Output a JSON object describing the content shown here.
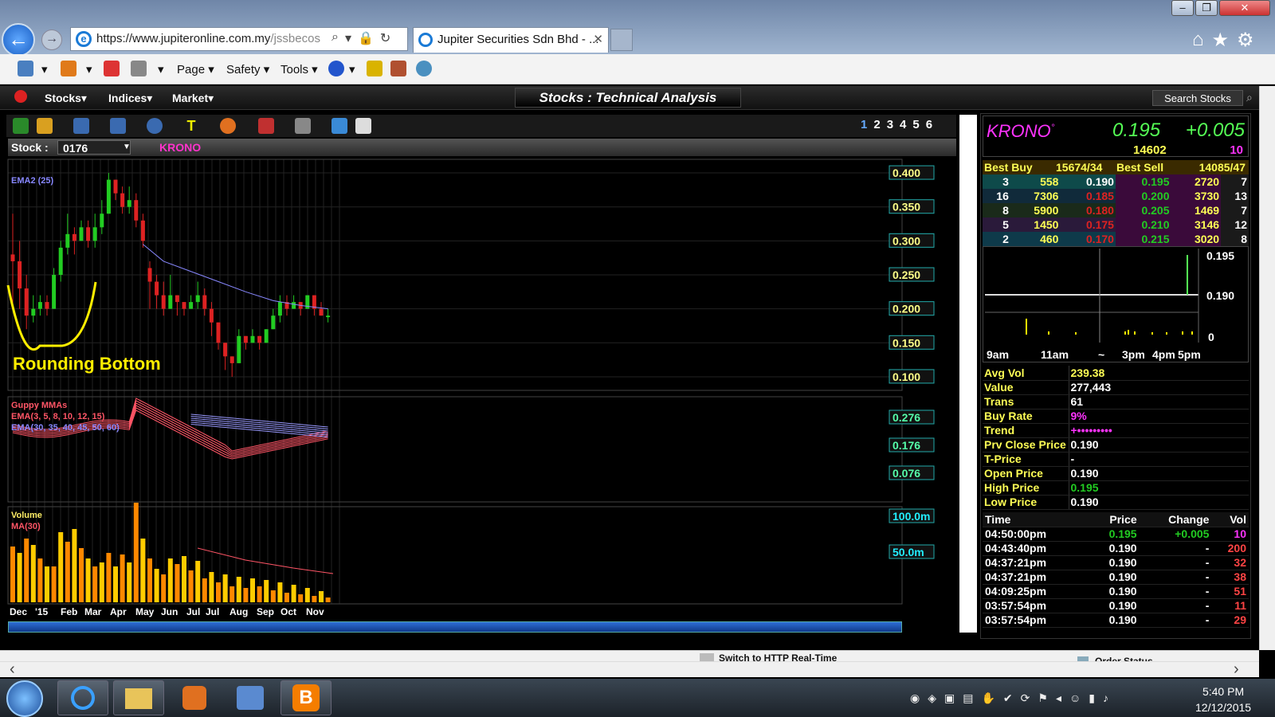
{
  "browser": {
    "url_main": "https://www.jupiteronline.com.my",
    "url_rest": "/jssbecos",
    "tab_title": "Jupiter Securities Sdn Bhd - ...",
    "tab_close": "✕"
  },
  "menu": {
    "page": "Page ▾",
    "safety": "Safety ▾",
    "tools": "Tools ▾"
  },
  "app": {
    "stocks": "Stocks▾",
    "indices": "Indices▾",
    "market": "Market▾",
    "title": "Stocks : Technical Analysis",
    "search": "Search Stocks"
  },
  "chart_toolbar": {
    "pages": [
      "1",
      "2",
      "3",
      "4",
      "5",
      "6"
    ]
  },
  "stock": {
    "label": "Stock :",
    "code": "0176",
    "name": "KRONO"
  },
  "chart_data": [
    {
      "type": "candlestick",
      "title": "",
      "legend": [
        "EMA2 (25)"
      ],
      "annotation": "Rounding Bottom",
      "ylim": [
        0.08,
        0.42
      ],
      "y_ticks": [
        "0.400",
        "0.350",
        "0.300",
        "0.250",
        "0.200",
        "0.150",
        "0.100"
      ],
      "x_ticks": [
        "Dec",
        "'15",
        "Feb",
        "Mar",
        "Apr",
        "May",
        "Jun",
        "Jul",
        "Jul",
        "Aug",
        "Sep",
        "Oct",
        "Nov"
      ],
      "candles": [
        [
          0.28,
          0.27,
          0.2,
          0.34
        ],
        [
          0.27,
          0.23,
          0.2,
          0.3
        ],
        [
          0.23,
          0.19,
          0.17,
          0.25
        ],
        [
          0.19,
          0.2,
          0.18,
          0.22
        ],
        [
          0.2,
          0.21,
          0.19,
          0.22
        ],
        [
          0.21,
          0.2,
          0.19,
          0.22
        ],
        [
          0.2,
          0.25,
          0.2,
          0.26
        ],
        [
          0.25,
          0.29,
          0.24,
          0.3
        ],
        [
          0.29,
          0.31,
          0.28,
          0.34
        ],
        [
          0.31,
          0.3,
          0.28,
          0.32
        ],
        [
          0.3,
          0.32,
          0.3,
          0.33
        ],
        [
          0.32,
          0.3,
          0.29,
          0.33
        ],
        [
          0.3,
          0.32,
          0.29,
          0.34
        ],
        [
          0.32,
          0.34,
          0.31,
          0.36
        ],
        [
          0.34,
          0.39,
          0.34,
          0.4
        ],
        [
          0.39,
          0.37,
          0.36,
          0.39
        ],
        [
          0.37,
          0.35,
          0.34,
          0.38
        ],
        [
          0.35,
          0.36,
          0.34,
          0.38
        ],
        [
          0.36,
          0.33,
          0.32,
          0.37
        ],
        [
          0.33,
          0.3,
          0.29,
          0.34
        ],
        [
          0.26,
          0.24,
          0.2,
          0.27
        ],
        [
          0.24,
          0.22,
          0.2,
          0.25
        ],
        [
          0.22,
          0.2,
          0.19,
          0.24
        ],
        [
          0.2,
          0.22,
          0.2,
          0.25
        ],
        [
          0.22,
          0.21,
          0.19,
          0.22
        ],
        [
          0.21,
          0.2,
          0.19,
          0.21
        ],
        [
          0.2,
          0.21,
          0.2,
          0.22
        ],
        [
          0.21,
          0.22,
          0.2,
          0.24
        ],
        [
          0.22,
          0.2,
          0.19,
          0.23
        ],
        [
          0.2,
          0.18,
          0.16,
          0.21
        ],
        [
          0.18,
          0.15,
          0.14,
          0.18
        ],
        [
          0.15,
          0.13,
          0.11,
          0.15
        ],
        [
          0.13,
          0.12,
          0.1,
          0.13
        ],
        [
          0.12,
          0.16,
          0.12,
          0.17
        ],
        [
          0.16,
          0.15,
          0.14,
          0.16
        ],
        [
          0.15,
          0.16,
          0.15,
          0.17
        ],
        [
          0.16,
          0.15,
          0.14,
          0.16
        ],
        [
          0.15,
          0.17,
          0.15,
          0.17
        ],
        [
          0.17,
          0.19,
          0.17,
          0.2
        ],
        [
          0.19,
          0.21,
          0.18,
          0.22
        ],
        [
          0.21,
          0.2,
          0.19,
          0.22
        ],
        [
          0.2,
          0.21,
          0.2,
          0.22
        ],
        [
          0.21,
          0.2,
          0.19,
          0.21
        ],
        [
          0.2,
          0.22,
          0.2,
          0.22
        ],
        [
          0.22,
          0.2,
          0.19,
          0.22
        ],
        [
          0.2,
          0.19,
          0.19,
          0.21
        ],
        [
          0.19,
          0.19,
          0.18,
          0.2
        ]
      ],
      "ema25": [
        [
          19,
          0.295
        ],
        [
          22,
          0.27
        ],
        [
          26,
          0.255
        ],
        [
          30,
          0.24
        ],
        [
          34,
          0.225
        ],
        [
          38,
          0.212
        ],
        [
          42,
          0.205
        ],
        [
          46,
          0.2
        ]
      ]
    },
    {
      "type": "line",
      "legend": [
        "Guppy MMAs",
        "EMA(3, 5, 8, 10, 12, 15)",
        "EMA(30, 35, 40, 45, 50, 60)"
      ],
      "y_ticks": [
        "0.276",
        "0.176",
        "0.076"
      ]
    },
    {
      "type": "bar",
      "legend": [
        "Volume",
        "MA(30)"
      ],
      "y_ticks": [
        "100.0m",
        "50.0m"
      ],
      "ylim": [
        0,
        120
      ],
      "values": [
        70,
        62,
        80,
        72,
        55,
        45,
        45,
        88,
        76,
        92,
        68,
        55,
        45,
        50,
        62,
        45,
        60,
        50,
        125,
        80,
        55,
        42,
        35,
        55,
        48,
        58,
        40,
        52,
        30,
        38,
        25,
        35,
        20,
        32,
        18,
        30,
        20,
        28,
        15,
        25,
        12,
        22,
        10,
        18,
        8,
        14,
        6
      ]
    }
  ],
  "quote": {
    "name": "KRONO",
    "suffix": "°",
    "price": "0.195",
    "change": "+0.005",
    "volume": "14602",
    "last_vol": "10"
  },
  "depth": {
    "head_bb": "Best Buy",
    "head_bbv": "15674/34",
    "head_bs": "Best Sell",
    "head_bsv": "14085/47",
    "rows": [
      [
        "3",
        "558",
        "0.190",
        "0.195",
        "2720",
        "7"
      ],
      [
        "16",
        "7306",
        "0.185",
        "0.200",
        "3730",
        "13"
      ],
      [
        "8",
        "5900",
        "0.180",
        "0.205",
        "1469",
        "7"
      ],
      [
        "5",
        "1450",
        "0.175",
        "0.210",
        "3146",
        "12"
      ],
      [
        "2",
        "460",
        "0.170",
        "0.215",
        "3020",
        "8"
      ]
    ]
  },
  "intraday": {
    "p_hi": "0.195",
    "p_lo": "0.190",
    "v0": "0",
    "times": [
      "9am",
      "11am",
      "~",
      "3pm",
      "4pm",
      "5pm"
    ]
  },
  "info": [
    [
      "Avg Vol",
      "239.38"
    ],
    [
      "Value",
      "277,443"
    ],
    [
      "Trans",
      "61"
    ],
    [
      "Buy Rate",
      "9%"
    ],
    [
      "Trend",
      "+•••••••••"
    ],
    [
      "Prv Close Price",
      "0.190"
    ],
    [
      "T-Price",
      "-"
    ],
    [
      "Open Price",
      "0.190"
    ],
    [
      "High Price",
      "0.195"
    ],
    [
      "Low Price",
      "0.190"
    ]
  ],
  "trades_head": [
    "Time",
    "Price",
    "Change",
    "Vol"
  ],
  "trades": [
    [
      "04:50:00pm",
      "0.195",
      "+0.005",
      "10"
    ],
    [
      "04:43:40pm",
      "0.190",
      "-",
      "200"
    ],
    [
      "04:37:21pm",
      "0.190",
      "-",
      "32"
    ],
    [
      "04:37:21pm",
      "0.190",
      "-",
      "38"
    ],
    [
      "04:09:25pm",
      "0.190",
      "-",
      "51"
    ],
    [
      "03:57:54pm",
      "0.190",
      "-",
      "11"
    ],
    [
      "03:57:54pm",
      "0.190",
      "-",
      "29"
    ]
  ],
  "status": {
    "switch": "Switch to HTTP Real-Time",
    "order": "Order Status"
  },
  "clock": {
    "time": "5:40 PM",
    "date": "12/12/2015"
  },
  "colors": {
    "up": "#22cc22",
    "down": "#dd2222",
    "ema": "#8888ff",
    "annot": "#ffee00"
  }
}
